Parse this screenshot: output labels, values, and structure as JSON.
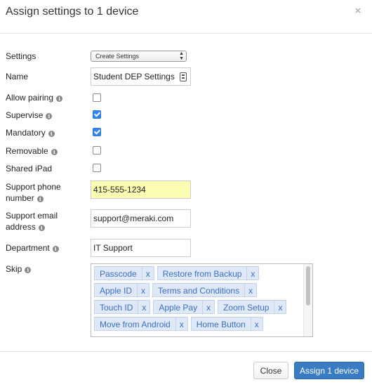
{
  "dialog": {
    "title": "Assign settings to 1 device",
    "close_glyph": "×"
  },
  "form": {
    "settings": {
      "label": "Settings",
      "value": "Create Settings"
    },
    "name": {
      "label": "Name",
      "value": "Student DEP Settings"
    },
    "allow_pairing": {
      "label": "Allow pairing",
      "checked": false
    },
    "supervise": {
      "label": "Supervise",
      "checked": true
    },
    "mandatory": {
      "label": "Mandatory",
      "checked": true
    },
    "removable": {
      "label": "Removable",
      "checked": false
    },
    "shared_ipad": {
      "label": "Shared iPad",
      "checked": false
    },
    "support_phone": {
      "label_line1": "Support phone",
      "label_line2": "number",
      "value": "415-555-1234"
    },
    "support_email": {
      "label_line1": "Support email",
      "label_line2": "address",
      "value": "support@meraki.com"
    },
    "department": {
      "label": "Department",
      "value": "IT Support"
    },
    "skip": {
      "label": "Skip",
      "remove_glyph": "x",
      "tags": [
        "Passcode",
        "Restore from Backup",
        "Apple ID",
        "Terms and Conditions",
        "Touch ID",
        "Apple Pay",
        "Zoom Setup",
        "Move from Android",
        "Home Button"
      ]
    }
  },
  "info_glyph": "i",
  "footer": {
    "close_label": "Close",
    "assign_label": "Assign 1 device"
  },
  "colors": {
    "primary_button": "#3a7cc2",
    "checkbox_checked": "#2f86f2",
    "phone_highlight": "#fbfdb2",
    "tag_background": "#dee8f7"
  }
}
